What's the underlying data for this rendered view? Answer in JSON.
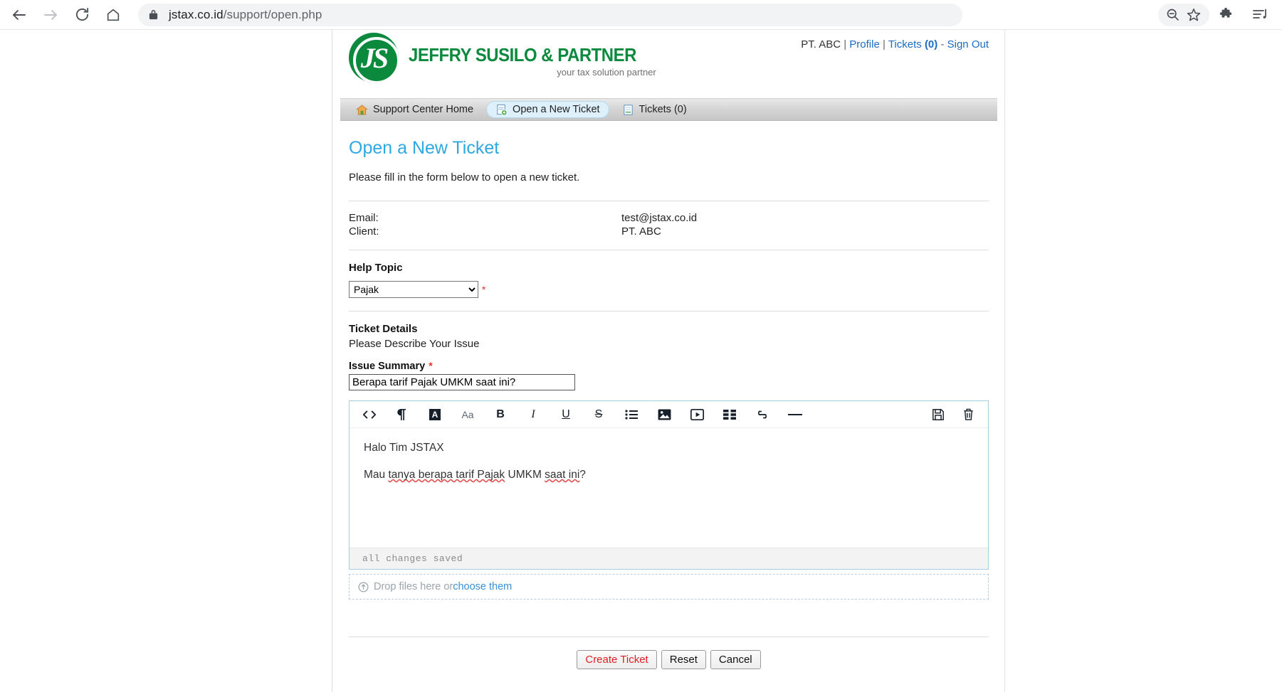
{
  "browser": {
    "url_host": "jstax.co.id",
    "url_path": "/support/open.php",
    "icons": {
      "back": "back-arrow-icon",
      "forward": "forward-arrow-icon",
      "reload": "reload-icon",
      "home": "home-icon",
      "lock": "lock-icon",
      "zoom_out": "zoom-out-icon",
      "bookmark": "star-icon",
      "extensions": "puzzle-piece-icon",
      "menu": "reading-list-icon"
    }
  },
  "site": {
    "logo": {
      "monogram": "JS",
      "name": "JEFFRY SUSILO & PARTNER",
      "tagline": "your tax solution partner"
    },
    "user_bar": {
      "client": "PT. ABC",
      "sep1": "|",
      "profile": "Profile",
      "sep2": "|",
      "tickets_label": "Tickets",
      "tickets_count": "(0)",
      "dash": "-",
      "sign_out": "Sign Out"
    },
    "nav": [
      {
        "label": "Support Center Home",
        "icon": "home-icon",
        "active": false
      },
      {
        "label": "Open a New Ticket",
        "icon": "new-document-icon",
        "active": true
      },
      {
        "label": "Tickets (0)",
        "icon": "document-icon",
        "active": false
      }
    ]
  },
  "page": {
    "title": "Open a New Ticket",
    "intro": "Please fill in the form below to open a new ticket.",
    "info": {
      "email_label": "Email:",
      "email_value": "test@jstax.co.id",
      "client_label": "Client:",
      "client_value": "PT. ABC"
    },
    "help_topic": {
      "heading": "Help Topic",
      "selected": "Pajak",
      "options": [
        "Pajak"
      ],
      "required_mark": "*"
    },
    "ticket_details": {
      "heading": "Ticket Details",
      "subheading": "Please Describe Your Issue",
      "issue_summary_label": "Issue Summary",
      "issue_summary_required": "*",
      "issue_summary_value": "Berapa tarif Pajak UMKM saat ini?"
    },
    "editor": {
      "toolbar": [
        "code-icon",
        "pilcrow-icon",
        "text-color-icon",
        "font-size-icon",
        "bold-icon",
        "italic-icon",
        "underline-icon",
        "strikethrough-icon",
        "bullet-list-icon",
        "image-icon",
        "video-icon",
        "table-icon",
        "link-icon",
        "horizontal-rule-icon",
        "save-icon",
        "trash-icon"
      ],
      "body_line_1": "Halo Tim JSTAX",
      "body_line_2_a": "Mau ",
      "body_line_2_b": "tanya berapa tarif Pajak",
      "body_line_2_c": " UMKM ",
      "body_line_2_d": "saat ini",
      "body_line_2_e": "?",
      "status": "all changes saved"
    },
    "dropzone": {
      "text": "Drop files here or ",
      "link": "choose them",
      "icon": "upload-circle-icon"
    },
    "actions": {
      "create": "Create Ticket",
      "reset": "Reset",
      "cancel": "Cancel"
    }
  },
  "colors": {
    "brand_green": "#0b8a3d",
    "heading_blue": "#2ea8e0",
    "link_blue": "#1a6cc4",
    "required_red": "#e03030",
    "primary_button_text": "#e02020"
  }
}
